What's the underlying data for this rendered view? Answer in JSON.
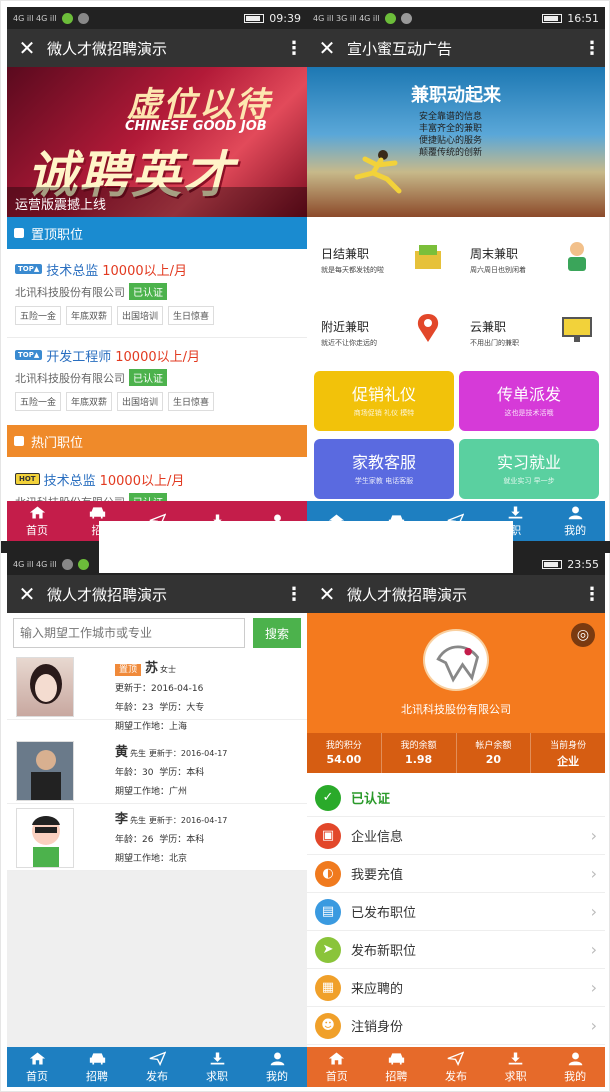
{
  "tl": {
    "status": {
      "signal": "4G ill 4G ill",
      "time": "09:39"
    },
    "title": "微人才微招聘演示",
    "banner": {
      "line1": "虚位以待",
      "en": "CHINESE GOOD JOB",
      "line2": "诚聘英才",
      "caption": "运营版震撼上线"
    },
    "sec_top": "置顶职位",
    "sec_hot": "热门职位",
    "jobs": [
      {
        "tag": "TOP▲",
        "title": "技术总监",
        "salary": "10000以上/月",
        "company": "北讯科技股份有限公司",
        "verified": "已认证",
        "perks": [
          "五险一金",
          "年底双薪",
          "出国培训",
          "生日惊喜"
        ]
      },
      {
        "tag": "TOP▲",
        "title": "开发工程师",
        "salary": "10000以上/月",
        "company": "北讯科技股份有限公司",
        "verified": "已认证",
        "perks": [
          "五险一金",
          "年底双薪",
          "出国培训",
          "生日惊喜"
        ]
      },
      {
        "tag": "HOT",
        "title": "技术总监",
        "salary": "10000以上/月",
        "company": "北讯科技股份有限公司",
        "verified": "已认证"
      }
    ],
    "tabs": [
      "首页",
      "招",
      "",
      "",
      ""
    ]
  },
  "tr": {
    "status": {
      "signal": "4G ill 3G ill 4G ill",
      "time": "16:51"
    },
    "title": "宣小蜜互动广告",
    "banner": {
      "title": "兼职动起来",
      "lines": [
        "安全靠谱的信息",
        "丰富齐全的兼职",
        "便捷贴心的服务",
        "颠覆传统的创新"
      ]
    },
    "cells": [
      {
        "title": "日结兼职",
        "sub": "就是每天都发钱的啦"
      },
      {
        "title": "周末兼职",
        "sub": "周六周日也别闲着"
      },
      {
        "title": "附近兼职",
        "sub": "就近不让你走远的"
      },
      {
        "title": "云兼职",
        "sub": "不用出门的兼职"
      }
    ],
    "tiles": [
      {
        "title": "促销礼仪",
        "sub": "商场促销 礼仪 模特"
      },
      {
        "title": "传单派发",
        "sub": "这也是技术活哦"
      },
      {
        "title": "家教客服",
        "sub": "学生家教 电话客服"
      },
      {
        "title": "实习就业",
        "sub": "就业实习 早一步"
      }
    ],
    "tabs": [
      "",
      "",
      "",
      "职",
      "我的"
    ]
  },
  "bl": {
    "status": {
      "signal": "4G ill 4G ill"
    },
    "title": "微人才微招聘演示",
    "search": {
      "placeholder": "输入期望工作城市或专业",
      "button": "搜索"
    },
    "people": [
      {
        "badge": "置顶",
        "name": "苏",
        "gender": "女士",
        "updated": "更新于：2016-04-16",
        "age": "年龄：23",
        "edu": "学历：大专",
        "place": "期望工作地：上海"
      },
      {
        "name": "黄",
        "gender": "先生",
        "updated": "更新于：2016-04-17",
        "age": "年龄：30",
        "edu": "学历：本科",
        "place": "期望工作地：广州"
      },
      {
        "name": "李",
        "gender": "先生",
        "updated": "更新于：2016-04-17",
        "age": "年龄：26",
        "edu": "学历：本科",
        "place": "期望工作地：北京"
      }
    ],
    "tabs": [
      "首页",
      "招聘",
      "发布",
      "求职",
      "我的"
    ]
  },
  "br": {
    "status": {
      "time": "23:55"
    },
    "title": "微人才微招聘演示",
    "company": "北讯科技股份有限公司",
    "stats": [
      {
        "label": "我的积分",
        "value": "54.00"
      },
      {
        "label": "我的余额",
        "value": "1.98"
      },
      {
        "label": "帐户余额",
        "value": "20"
      },
      {
        "label": "当前身份",
        "value": "企业"
      }
    ],
    "verified": "已认证",
    "menu": [
      "企业信息",
      "我要充值",
      "已发布职位",
      "发布新职位",
      "来应聘的",
      "注销身份"
    ],
    "tabs": [
      "首页",
      "招聘",
      "发布",
      "求职",
      "我的"
    ]
  },
  "colors": {
    "red_tab": "#c41d4a",
    "blue_tab": "#1e7fc1",
    "orange_tab": "#e66a2a",
    "green": "#4cb24c"
  }
}
